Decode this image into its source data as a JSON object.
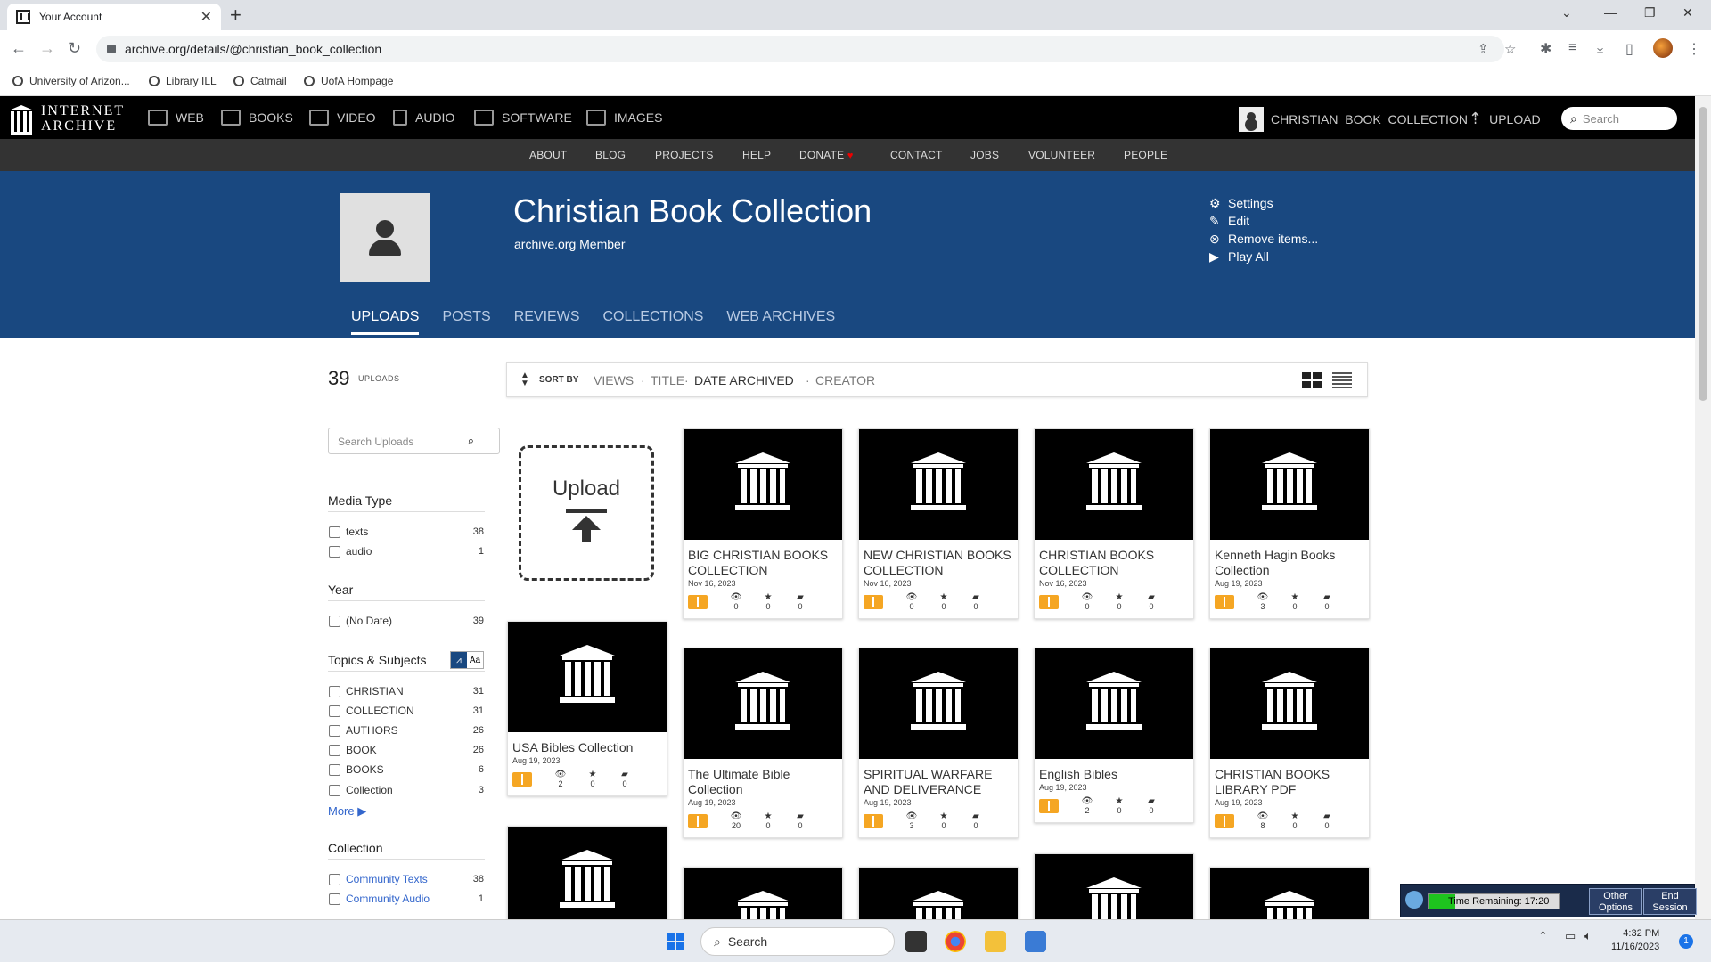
{
  "browser": {
    "tab_title": "Your Account",
    "new_tab": "+",
    "url": "archive.org/details/@christian_book_collection",
    "bookmarks": [
      "University of Arizon...",
      "Library ILL",
      "Catmail",
      "UofA Hompage"
    ]
  },
  "ia_nav": {
    "logo_line1": "INTERNET",
    "logo_line2": "ARCHIVE",
    "items": [
      "WEB",
      "BOOKS",
      "VIDEO",
      "AUDIO",
      "SOFTWARE",
      "IMAGES"
    ],
    "account": "CHRISTIAN_BOOK_COLLECTION",
    "upload": "UPLOAD",
    "search_placeholder": "Search",
    "sub_items": [
      "ABOUT",
      "BLOG",
      "PROJECTS",
      "HELP",
      "DONATE",
      "CONTACT",
      "JOBS",
      "VOLUNTEER",
      "PEOPLE"
    ]
  },
  "profile": {
    "title": "Christian Book Collection",
    "subtitle": "archive.org Member",
    "actions": [
      "Settings",
      "Edit",
      "Remove items...",
      "Play All"
    ],
    "tabs": [
      "UPLOADS",
      "POSTS",
      "REVIEWS",
      "COLLECTIONS",
      "WEB ARCHIVES"
    ],
    "active_tab": "UPLOADS"
  },
  "sidebar": {
    "count": "39",
    "count_label": "UPLOADS",
    "search_placeholder": "Search Uploads",
    "media_type_title": "Media Type",
    "media_type": [
      {
        "label": "texts",
        "count": "38"
      },
      {
        "label": "audio",
        "count": "1"
      }
    ],
    "year_title": "Year",
    "year": [
      {
        "label": "(No Date)",
        "count": "39"
      }
    ],
    "topics_title": "Topics & Subjects",
    "topics_toggle": "Aa",
    "topics": [
      {
        "label": "CHRISTIAN",
        "count": "31"
      },
      {
        "label": "COLLECTION",
        "count": "31"
      },
      {
        "label": "AUTHORS",
        "count": "26"
      },
      {
        "label": "BOOK",
        "count": "26"
      },
      {
        "label": "BOOKS",
        "count": "6"
      },
      {
        "label": "Collection",
        "count": "3"
      }
    ],
    "more": "More",
    "collection_title": "Collection",
    "collection": [
      {
        "label": "Community Texts",
        "count": "38"
      },
      {
        "label": "Community Audio",
        "count": "1"
      }
    ]
  },
  "sort": {
    "label": "SORT BY",
    "options": [
      "VIEWS",
      "TITLE",
      "DATE ARCHIVED",
      "CREATOR"
    ],
    "selected": "DATE ARCHIVED"
  },
  "upload_tile": "Upload",
  "items": [
    {
      "title": "BIG CHRISTIAN BOOKS COLLECTION",
      "date": "Nov 16, 2023",
      "views": "0",
      "favs": "0",
      "reviews": "0"
    },
    {
      "title": "NEW CHRISTIAN BOOKS COLLECTION",
      "date": "Nov 16, 2023",
      "views": "0",
      "favs": "0",
      "reviews": "0"
    },
    {
      "title": "CHRISTIAN BOOKS COLLECTION",
      "date": "Nov 16, 2023",
      "views": "0",
      "favs": "0",
      "reviews": "0"
    },
    {
      "title": "Kenneth Hagin Books Collection",
      "date": "Aug 19, 2023",
      "views": "3",
      "favs": "0",
      "reviews": "0"
    },
    {
      "title": "USA Bibles Collection",
      "date": "Aug 19, 2023",
      "views": "2",
      "favs": "0",
      "reviews": "0"
    },
    {
      "title": "The Ultimate Bible Collection",
      "date": "Aug 19, 2023",
      "views": "20",
      "favs": "0",
      "reviews": "0"
    },
    {
      "title": "SPIRITUAL WARFARE AND DELIVERANCE",
      "date": "Aug 19, 2023",
      "views": "3",
      "favs": "0",
      "reviews": "0"
    },
    {
      "title": "English Bibles",
      "date": "Aug 19, 2023",
      "views": "2",
      "favs": "0",
      "reviews": "0"
    },
    {
      "title": "CHRISTIAN BOOKS LIBRARY PDF",
      "date": "Aug 19, 2023",
      "views": "8",
      "favs": "0",
      "reviews": "0"
    }
  ],
  "session": {
    "timer": "Time Remaining: 17:20",
    "other_options": "Other Options",
    "end_session": "End Session"
  },
  "taskbar": {
    "search": "Search",
    "time": "4:32 PM",
    "date": "11/16/2023",
    "notifications": "1"
  }
}
